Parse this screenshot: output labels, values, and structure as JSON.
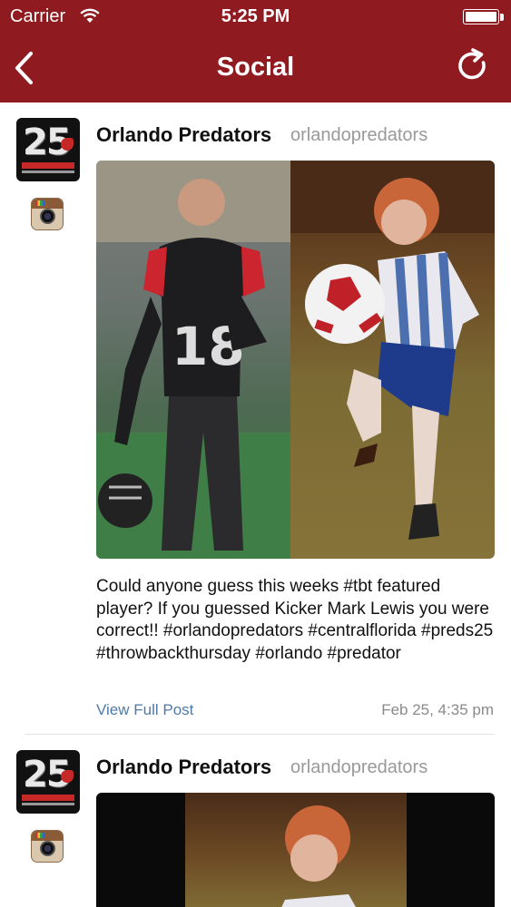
{
  "status_bar": {
    "carrier": "Carrier",
    "time": "5:25 PM"
  },
  "nav": {
    "title": "Social",
    "back_icon": "chevron-left-icon",
    "refresh_icon": "refresh-icon"
  },
  "colors": {
    "header_bg": "#8f1a1f",
    "link": "#4f7aa8",
    "muted": "#999999"
  },
  "posts": [
    {
      "author": "Orlando Predators",
      "handle": "orlandopredators",
      "avatar_text": "25",
      "source_icon": "instagram-icon",
      "caption": "Could anyone guess this weeks #tbt featured player? If you guessed Kicker Mark Lewis you were correct!! #orlandopredators #centralflorida #preds25 #throwbackthursday #orlando #predator",
      "link_label": "View Full Post",
      "date": "Feb 25, 4:35 pm"
    },
    {
      "author": "Orlando Predators",
      "handle": "orlandopredators",
      "avatar_text": "25",
      "source_icon": "instagram-icon"
    }
  ]
}
